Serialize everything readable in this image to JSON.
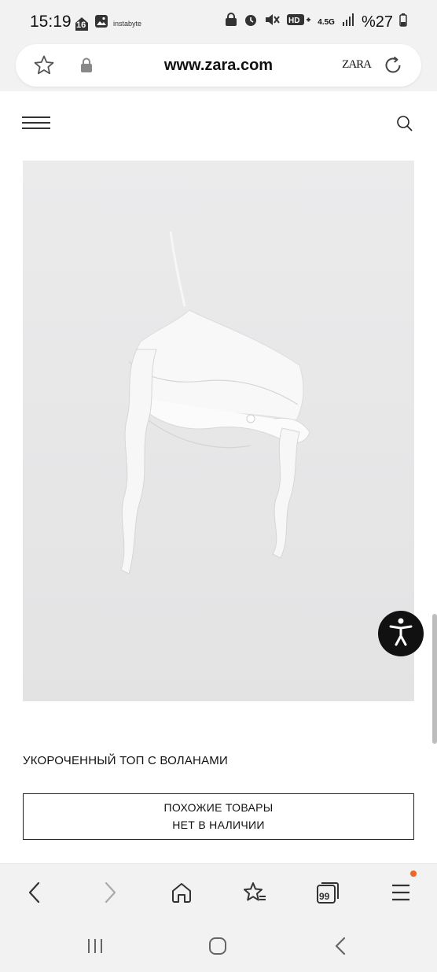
{
  "status_bar": {
    "time": "15:19",
    "calendar_day": "16",
    "tiny_label": "instabyte",
    "network": "4.5G",
    "battery": "%27"
  },
  "address_bar": {
    "url": "www.zara.com",
    "site_logo": "ZARA"
  },
  "product": {
    "title": "УКОРОЧЕННЫЙ ТОП С ВОЛАНАМИ",
    "similar_label": "ПОХОЖИЕ ТОВАРЫ",
    "availability": "НЕТ В НАЛИЧИИ"
  },
  "toolbar": {
    "tabs_count": "99"
  },
  "icons": {
    "status": [
      "home-notification-icon",
      "gallery-icon",
      "lock-screen-icon",
      "alarm-icon",
      "mute-icon",
      "hd-volte-icon",
      "signal-icon",
      "battery-icon"
    ],
    "address": [
      "star-icon",
      "lock-icon",
      "refresh-icon"
    ],
    "header": [
      "hamburger-menu-icon",
      "search-icon"
    ],
    "toolbar": [
      "back-icon",
      "forward-icon",
      "home-icon",
      "bookmarks-icon",
      "tabs-icon",
      "menu-icon"
    ],
    "system": [
      "recent-apps-icon",
      "home-button-icon",
      "system-back-icon"
    ]
  },
  "colors": {
    "accent_notification": "#f26522",
    "accessibility_button": "#111111"
  }
}
